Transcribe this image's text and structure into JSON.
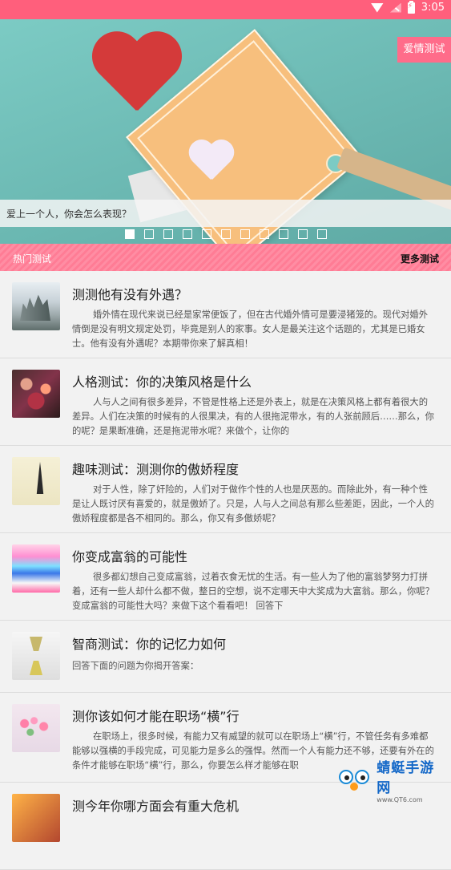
{
  "status_bar": {
    "time": "3:05"
  },
  "banner": {
    "category_tag": "爱情测试",
    "caption": "爱上一个人，你会怎么表现？",
    "slide_count": 11,
    "active_index": 0
  },
  "section": {
    "title": "热门测试",
    "more_label": "更多测试"
  },
  "items": [
    {
      "title": "测测他有没有外遇？",
      "desc": "婚外情在现代来说已经是家常便饭了，但在古代婚外情可是要浸猪笼的。现代对婚外情倒是没有明文规定处罚，毕竟是别人的家事。女人是最关注这个话题的，尤其是已婚女士。他有没有外遇呢？本期带你来了解真相！",
      "indent": true
    },
    {
      "title": "人格测试：你的决策风格是什么",
      "desc": "人与人之间有很多差异，不管是性格上还是外表上，就是在决策风格上都有着很大的差异。人们在决策的时候有的人很果决，有的人很拖泥带水，有的人张前顾后……那么，你的呢？是果断准确，还是拖泥带水呢？来做个，让你的",
      "indent": true
    },
    {
      "title": "趣味测试：测测你的傲娇程度",
      "desc": "对于人性，除了奸险的，人们对于做作个性的人也是厌恶的。而除此外，有一种个性是让人既讨厌有喜爱的，就是傲娇了。只是，人与人之间总有那么些差距，因此，一个人的傲娇程度都是各不相同的。那么，你又有多傲娇呢？",
      "indent": true
    },
    {
      "title": "你变成富翁的可能性",
      "desc": "很多都幻想自己变成富翁，过着衣食无忧的生活。有一些人为了他的富翁梦努力打拼着，还有一些人却什么都不做，整日的空想，说不定哪天中大奖成为大富翁。那么，你呢？变成富翁的可能性大吗？来做下这个看看吧！ 回答下",
      "indent": true
    },
    {
      "title": "智商测试：你的记忆力如何",
      "desc": "回答下面的问题为你揭开答案：",
      "indent": false
    },
    {
      "title": "测你该如何才能在职场“横”行",
      "desc": "在职场上，很多时候，有能力又有威望的就可以在职场上“横”行，不管任务有多难都能够以强横的手段完成，可见能力是多么的强悍。然而一个人有能力还不够，还要有外在的条件才能够在职场“横”行，那么，你要怎么样才能够在职",
      "indent": true
    },
    {
      "title": "测今年你哪方面会有重大危机",
      "desc": "",
      "indent": false
    }
  ],
  "watermark": {
    "name": "蜻蜓手游网",
    "url": "www.QT6.com"
  },
  "colors": {
    "accent": "#ff5f7c",
    "tag": "#ff6c8a"
  }
}
